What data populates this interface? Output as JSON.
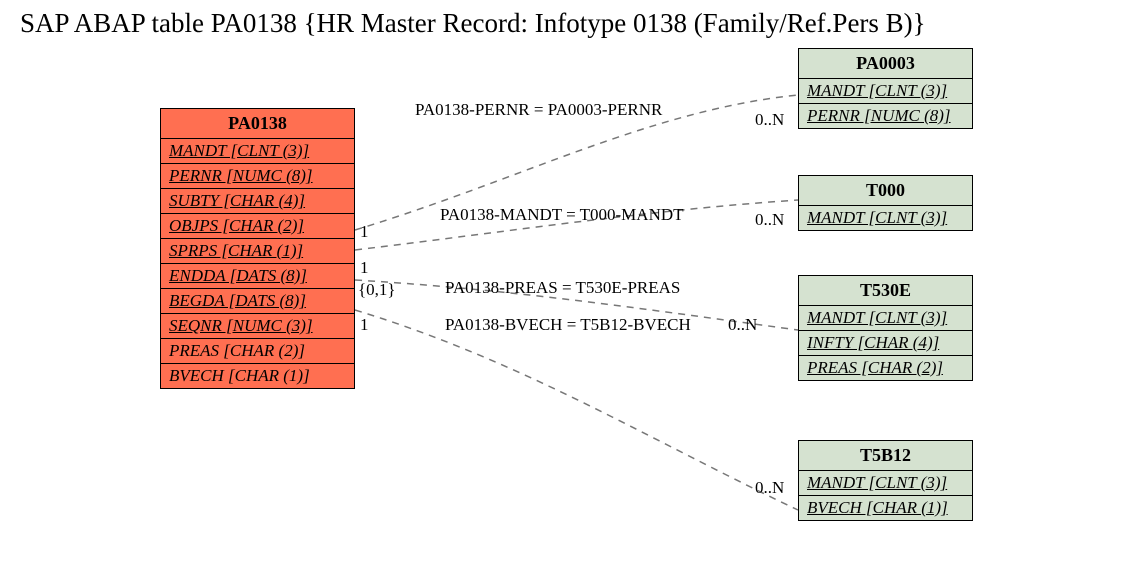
{
  "title": "SAP ABAP table PA0138 {HR Master Record: Infotype 0138 (Family/Ref.Pers B)}",
  "main_table": {
    "name": "PA0138",
    "fields": [
      {
        "txt": "MANDT [CLNT (3)]",
        "key": true
      },
      {
        "txt": "PERNR [NUMC (8)]",
        "key": true
      },
      {
        "txt": "SUBTY [CHAR (4)]",
        "key": true
      },
      {
        "txt": "OBJPS [CHAR (2)]",
        "key": true
      },
      {
        "txt": "SPRPS [CHAR (1)]",
        "key": true
      },
      {
        "txt": "ENDDA [DATS (8)]",
        "key": true
      },
      {
        "txt": "BEGDA [DATS (8)]",
        "key": true
      },
      {
        "txt": "SEQNR [NUMC (3)]",
        "key": true
      },
      {
        "txt": "PREAS [CHAR (2)]",
        "key": false
      },
      {
        "txt": "BVECH [CHAR (1)]",
        "key": false
      }
    ]
  },
  "related": [
    {
      "name": "PA0003",
      "fields": [
        {
          "txt": "MANDT [CLNT (3)]",
          "key": true
        },
        {
          "txt": "PERNR [NUMC (8)]",
          "key": true
        }
      ]
    },
    {
      "name": "T000",
      "fields": [
        {
          "txt": "MANDT [CLNT (3)]",
          "key": true
        }
      ]
    },
    {
      "name": "T530E",
      "fields": [
        {
          "txt": "MANDT [CLNT (3)]",
          "key": true
        },
        {
          "txt": "INFTY [CHAR (4)]",
          "key": true
        },
        {
          "txt": "PREAS [CHAR (2)]",
          "key": true
        }
      ]
    },
    {
      "name": "T5B12",
      "fields": [
        {
          "txt": "MANDT [CLNT (3)]",
          "key": true
        },
        {
          "txt": "BVECH [CHAR (1)]",
          "key": true
        }
      ]
    }
  ],
  "joins": [
    {
      "text": "PA0138-PERNR = PA0003-PERNR",
      "left_card": "",
      "right_card": "0..N"
    },
    {
      "text": "PA0138-MANDT = T000-MANDT",
      "left_card": "1",
      "right_card": "0..N"
    },
    {
      "text": "PA0138-PREAS = T530E-PREAS",
      "left_card": "1",
      "right_card": ""
    },
    {
      "text": "PA0138-BVECH = T5B12-BVECH",
      "left_card": "1",
      "right_card": "0..N"
    }
  ],
  "extra_cards": {
    "zero_one": "{0,1}",
    "t5b12_right": "0..N"
  }
}
